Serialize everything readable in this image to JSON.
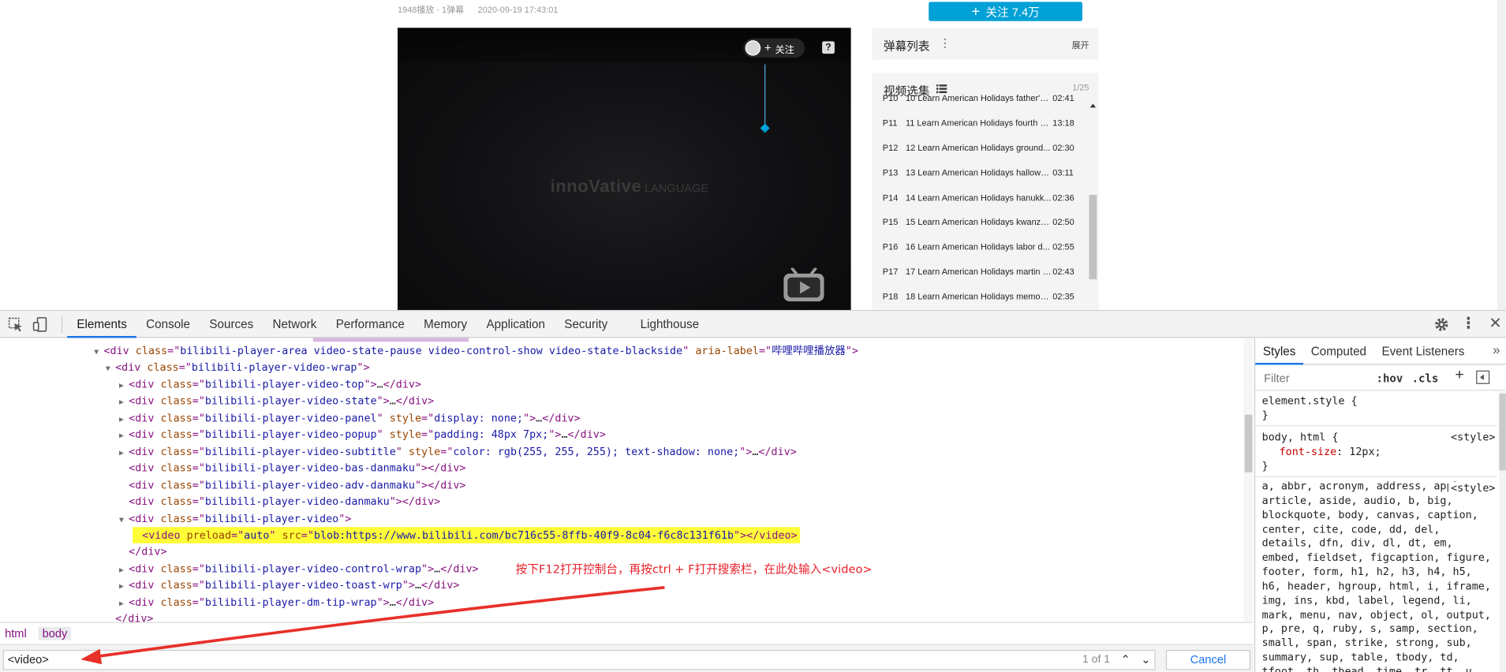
{
  "page": {
    "meta_plays": "1948播放 · 1弹幕",
    "meta_date": "2020-09-19 17:43:01",
    "follow_button": "关注 7.4万",
    "player": {
      "follow_label": "关注",
      "watermark_brand": "innoVative",
      "watermark_sub": "LANGUAGE"
    },
    "danmaku": {
      "title": "弹幕列表",
      "expand_label": "展开"
    },
    "playlist": {
      "title": "视频选集",
      "count": "1/25",
      "items": [
        {
          "idx": "P10",
          "name": "10 Learn American Holidays father's ...",
          "duration": "02:41"
        },
        {
          "idx": "P11",
          "name": "11 Learn American Holidays fourth of...",
          "duration": "13:18"
        },
        {
          "idx": "P12",
          "name": "12 Learn American Holidays ground...",
          "duration": "02:30"
        },
        {
          "idx": "P13",
          "name": "13 Learn American Holidays hallowe...",
          "duration": "03:11"
        },
        {
          "idx": "P14",
          "name": "14 Learn American Holidays hanukk...",
          "duration": "02:36"
        },
        {
          "idx": "P15",
          "name": "15 Learn American Holidays kwanza...",
          "duration": "02:50"
        },
        {
          "idx": "P16",
          "name": "16 Learn American Holidays labor d...",
          "duration": "02:55"
        },
        {
          "idx": "P17",
          "name": "17 Learn American Holidays martin l...",
          "duration": "02:43"
        },
        {
          "idx": "P18",
          "name": "18 Learn American Holidays memori...",
          "duration": "02:35"
        }
      ]
    }
  },
  "devtools": {
    "tabs": [
      "Elements",
      "Console",
      "Sources",
      "Network",
      "Performance",
      "Memory",
      "Application",
      "Security",
      "Lighthouse"
    ],
    "active_tab": "Elements",
    "dom_lines": [
      {
        "indent": 110,
        "tri": "▼",
        "parts": [
          [
            "tag",
            "<div "
          ],
          [
            "attr",
            "class"
          ],
          [
            "tag",
            "=\""
          ],
          [
            "val",
            "bilibili-player-area video-state-pause video-control-show video-state-blackside"
          ],
          [
            "tag",
            "\" "
          ],
          [
            "attr",
            "aria-label"
          ],
          [
            "tag",
            "=\""
          ],
          [
            "val",
            "哔哩哔哩播放器"
          ],
          [
            "tag",
            "\">"
          ]
        ]
      },
      {
        "indent": 122,
        "tri": "▼",
        "parts": [
          [
            "tag",
            "<div "
          ],
          [
            "attr",
            "class"
          ],
          [
            "tag",
            "=\""
          ],
          [
            "val",
            "bilibili-player-video-wrap"
          ],
          [
            "tag",
            "\">"
          ]
        ]
      },
      {
        "indent": 136,
        "tri": "▶",
        "parts": [
          [
            "tag",
            "<div "
          ],
          [
            "attr",
            "class"
          ],
          [
            "tag",
            "=\""
          ],
          [
            "val",
            "bilibili-player-video-top"
          ],
          [
            "tag",
            "\">"
          ],
          [
            "txt",
            "…"
          ],
          [
            "tag",
            "</div>"
          ]
        ]
      },
      {
        "indent": 136,
        "tri": "▶",
        "parts": [
          [
            "tag",
            "<div "
          ],
          [
            "attr",
            "class"
          ],
          [
            "tag",
            "=\""
          ],
          [
            "val",
            "bilibili-player-video-state"
          ],
          [
            "tag",
            "\">"
          ],
          [
            "txt",
            "…"
          ],
          [
            "tag",
            "</div>"
          ]
        ]
      },
      {
        "indent": 136,
        "tri": "▶",
        "parts": [
          [
            "tag",
            "<div "
          ],
          [
            "attr",
            "class"
          ],
          [
            "tag",
            "=\""
          ],
          [
            "val",
            "bilibili-player-video-panel"
          ],
          [
            "tag",
            "\" "
          ],
          [
            "attr",
            "style"
          ],
          [
            "tag",
            "=\""
          ],
          [
            "val",
            "display: none;"
          ],
          [
            "tag",
            "\">"
          ],
          [
            "txt",
            "…"
          ],
          [
            "tag",
            "</div>"
          ]
        ]
      },
      {
        "indent": 136,
        "tri": "▶",
        "parts": [
          [
            "tag",
            "<div "
          ],
          [
            "attr",
            "class"
          ],
          [
            "tag",
            "=\""
          ],
          [
            "val",
            "bilibili-player-video-popup"
          ],
          [
            "tag",
            "\" "
          ],
          [
            "attr",
            "style"
          ],
          [
            "tag",
            "=\""
          ],
          [
            "val",
            "padding: 48px 7px;"
          ],
          [
            "tag",
            "\">"
          ],
          [
            "txt",
            "…"
          ],
          [
            "tag",
            "</div>"
          ]
        ]
      },
      {
        "indent": 136,
        "tri": "▶",
        "parts": [
          [
            "tag",
            "<div "
          ],
          [
            "attr",
            "class"
          ],
          [
            "tag",
            "=\""
          ],
          [
            "val",
            "bilibili-player-video-subtitle"
          ],
          [
            "tag",
            "\" "
          ],
          [
            "attr",
            "style"
          ],
          [
            "tag",
            "=\""
          ],
          [
            "val",
            "color: rgb(255, 255, 255); text-shadow: none;"
          ],
          [
            "tag",
            "\">"
          ],
          [
            "txt",
            "…"
          ],
          [
            "tag",
            "</div>"
          ]
        ]
      },
      {
        "indent": 136,
        "tri": "",
        "parts": [
          [
            "tag",
            "<div "
          ],
          [
            "attr",
            "class"
          ],
          [
            "tag",
            "=\""
          ],
          [
            "val",
            "bilibili-player-video-bas-danmaku"
          ],
          [
            "tag",
            "\">"
          ],
          [
            "tag",
            "</div>"
          ]
        ]
      },
      {
        "indent": 136,
        "tri": "",
        "parts": [
          [
            "tag",
            "<div "
          ],
          [
            "attr",
            "class"
          ],
          [
            "tag",
            "=\""
          ],
          [
            "val",
            "bilibili-player-video-adv-danmaku"
          ],
          [
            "tag",
            "\">"
          ],
          [
            "tag",
            "</div>"
          ]
        ]
      },
      {
        "indent": 136,
        "tri": "",
        "parts": [
          [
            "tag",
            "<div "
          ],
          [
            "attr",
            "class"
          ],
          [
            "tag",
            "=\""
          ],
          [
            "val",
            "bilibili-player-video-danmaku"
          ],
          [
            "tag",
            "\">"
          ],
          [
            "tag",
            "</div>"
          ]
        ]
      },
      {
        "indent": 136,
        "tri": "▼",
        "parts": [
          [
            "tag",
            "<div "
          ],
          [
            "attr",
            "class"
          ],
          [
            "tag",
            "=\""
          ],
          [
            "val",
            "bilibili-player-video"
          ],
          [
            "tag",
            "\">"
          ]
        ]
      },
      {
        "indent": 150,
        "tri": "",
        "highlight": true,
        "parts": [
          [
            "tag",
            "<video "
          ],
          [
            "attr",
            "preload"
          ],
          [
            "tag",
            "=\""
          ],
          [
            "val",
            "auto"
          ],
          [
            "tag",
            "\" "
          ],
          [
            "attr",
            "src"
          ],
          [
            "tag",
            "=\""
          ],
          [
            "val",
            "blob:https://www.bilibili.com/bc716c55-8ffb-40f9-8c04-f6c8c131f61b"
          ],
          [
            "tag",
            "\">"
          ],
          [
            "tag",
            "</video>"
          ]
        ]
      },
      {
        "indent": 136,
        "tri": "",
        "parts": [
          [
            "tag",
            "</div>"
          ]
        ]
      },
      {
        "indent": 136,
        "tri": "▶",
        "parts": [
          [
            "tag",
            "<div "
          ],
          [
            "attr",
            "class"
          ],
          [
            "tag",
            "=\""
          ],
          [
            "val",
            "bilibili-player-video-control-wrap"
          ],
          [
            "tag",
            "\">"
          ],
          [
            "txt",
            "…"
          ],
          [
            "tag",
            "</div>"
          ]
        ]
      },
      {
        "indent": 136,
        "tri": "▶",
        "parts": [
          [
            "tag",
            "<div "
          ],
          [
            "attr",
            "class"
          ],
          [
            "tag",
            "=\""
          ],
          [
            "val",
            "bilibili-player-video-toast-wrp"
          ],
          [
            "tag",
            "\">"
          ],
          [
            "txt",
            "…"
          ],
          [
            "tag",
            "</div>"
          ]
        ]
      },
      {
        "indent": 136,
        "tri": "▶",
        "parts": [
          [
            "tag",
            "<div "
          ],
          [
            "attr",
            "class"
          ],
          [
            "tag",
            "=\""
          ],
          [
            "val",
            "bilibili-player-dm-tip-wrap"
          ],
          [
            "tag",
            "\">"
          ],
          [
            "txt",
            "…"
          ],
          [
            "tag",
            "</div>"
          ]
        ]
      },
      {
        "indent": 122,
        "tri": "",
        "parts": [
          [
            "tag",
            "</div>"
          ]
        ]
      }
    ],
    "annotation": "按下F12打开控制台，再按ctrl + F打开搜索栏，在此处输入<video>",
    "breadcrumbs": [
      "html",
      "body"
    ],
    "search": {
      "value": "<video>",
      "count": "1 of 1",
      "cancel_label": "Cancel"
    },
    "styles": {
      "tabs": [
        "Styles",
        "Computed",
        "Event Listeners"
      ],
      "more_label": "»",
      "filter_placeholder": "Filter",
      "hov_label": ":hov",
      "cls_label": ".cls",
      "plus_label": "+",
      "rule1_selector": "element.style {",
      "rule1_close": "}",
      "rule2_selector": "body, html {",
      "rule2_source": "<style>",
      "rule2_prop": "font-size",
      "rule2_value": "12px;",
      "rule2_close": "}",
      "rule3_source": "<style>",
      "rule3_selectors": "a, abbr, acronym, address, applet, article, aside, audio, b, big, blockquote, body, canvas, caption, center, cite, code, dd, del, details, dfn, div, dl, dt, em, embed, fieldset, figcaption, figure, footer, form, h1, h2, h3, h4, h5, h6, header, hgroup, html, i, iframe, img, ins, kbd, label, legend, li, mark, menu, nav, object, ol, output, p, pre, q, ruby, s, samp, section, small, span, strike, strong, sub, summary, sup, table, tbody, td, tfoot, th, thead, time, tr, tt, u"
    }
  }
}
